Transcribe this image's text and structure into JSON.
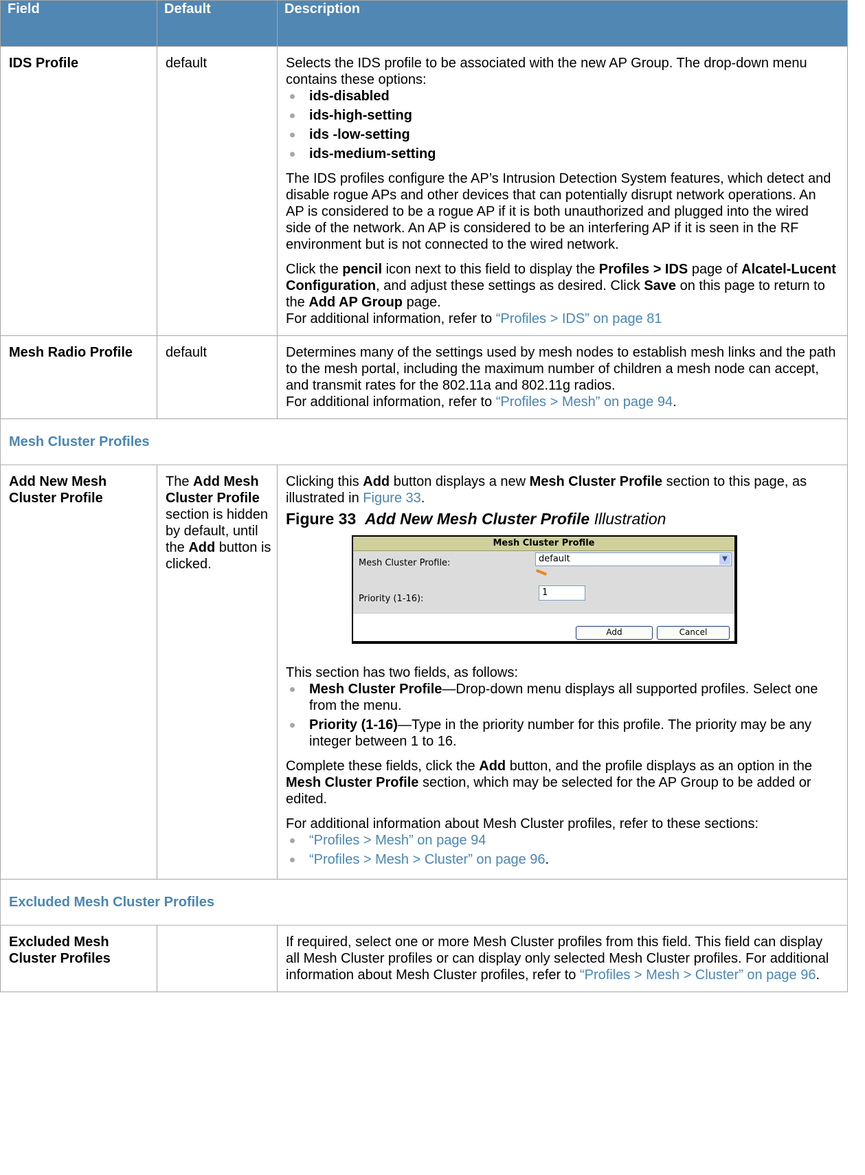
{
  "headers": {
    "field": "Field",
    "default": "Default",
    "description": "Description"
  },
  "ids": {
    "field": "IDS Profile",
    "default": "default",
    "intro": "Selects the IDS profile to be associated with the new AP Group. The drop-down menu contains these options:",
    "options": [
      "ids-disabled",
      "ids-high-setting",
      "ids -low-setting",
      "ids-medium-setting"
    ],
    "explain": "The IDS profiles configure the AP’s Intrusion Detection System features, which detect and disable rogue APs and other devices that can potentially disrupt network operations. An AP is considered to be a rogue AP if it is both unauthorized and plugged into the wired side of the network. An AP is considered to be an interfering AP if it is seen in the RF environment but is not connected to the wired network.",
    "click_1": "Click the ",
    "click_pencil": "pencil",
    "click_2": " icon next to this field to display the ",
    "click_page": "Profiles > IDS",
    "click_3": " page of ",
    "click_config": "Alcatel-Lucent Configuration",
    "click_4": ", and adjust these settings as desired. Click ",
    "click_save": "Save",
    "click_5": " on this page to return to the ",
    "click_add_group": "Add AP Group",
    "click_6": " page.",
    "ref_prefix": "For additional information, refer to ",
    "ref_link": "“Profiles > IDS” on page 81"
  },
  "mesh_radio": {
    "field": "Mesh Radio Profile",
    "default": "default",
    "desc": "Determines many of the settings used by mesh nodes to establish mesh links and the path to the mesh portal, including the maximum number of children a mesh node can accept, and transmit rates for the 802.11a and 802.11g radios.",
    "ref_prefix": "For additional information, refer to ",
    "ref_link": "“Profiles > Mesh” on page 94",
    "ref_suffix": "."
  },
  "section_cluster": "Mesh Cluster Profiles",
  "add_cluster": {
    "field": "Add New Mesh Cluster Profile",
    "def_1": "The ",
    "def_add": "Add Mesh Cluster Profile",
    "def_2": " section is hidden by default, until the ",
    "def_add2": "Add",
    "def_3": " button is clicked.",
    "intro_1": "Clicking this ",
    "intro_add": "Add",
    "intro_2": " button displays a new ",
    "intro_section": "Mesh Cluster Profile",
    "intro_3": " section to this page, as illustrated in ",
    "intro_fig": "Figure 33",
    "intro_4": ".",
    "fig_num": "Figure 33",
    "fig_title": "Add New Mesh Cluster Profile",
    "fig_suffix": "Illustration",
    "fields_intro": "This section has two fields, as follows:",
    "f1_name": "Mesh Cluster Profile",
    "f1_desc": "—Drop-down menu displays all supported profiles. Select one from the menu.",
    "f2_name": "Priority (1-16)",
    "f2_desc": "—Type in the priority number for this profile. The priority may be any integer between 1 to 16.",
    "complete_1": "Complete these fields, click the ",
    "complete_add": "Add",
    "complete_2": " button, and the profile displays as an option in the ",
    "complete_section": "Mesh Cluster Profile",
    "complete_3": " section, which may be selected for the AP Group to be added or edited.",
    "more_info": "For additional information about Mesh Cluster profiles, refer to these sections:",
    "link1": "“Profiles > Mesh” on page 94",
    "link2": "“Profiles > Mesh > Cluster” on page 96",
    "link2_suffix": "."
  },
  "mock": {
    "title": "Mesh Cluster Profile",
    "profile_label": "Mesh Cluster Profile:",
    "profile_value": "default",
    "priority_label": "Priority (1-16):",
    "priority_value": "1",
    "add_btn": "Add",
    "cancel_btn": "Cancel"
  },
  "section_excluded": "Excluded Mesh Cluster Profiles",
  "excluded": {
    "field": "Excluded Mesh Cluster Profiles",
    "desc": "If required, select one or more Mesh Cluster profiles from this field. This field can display all Mesh Cluster profiles or can display only selected Mesh Cluster profiles. For additional information about Mesh Cluster profiles, refer to ",
    "ref_link": "“Profiles > Mesh > Cluster” on page 96",
    "ref_suffix": "."
  }
}
